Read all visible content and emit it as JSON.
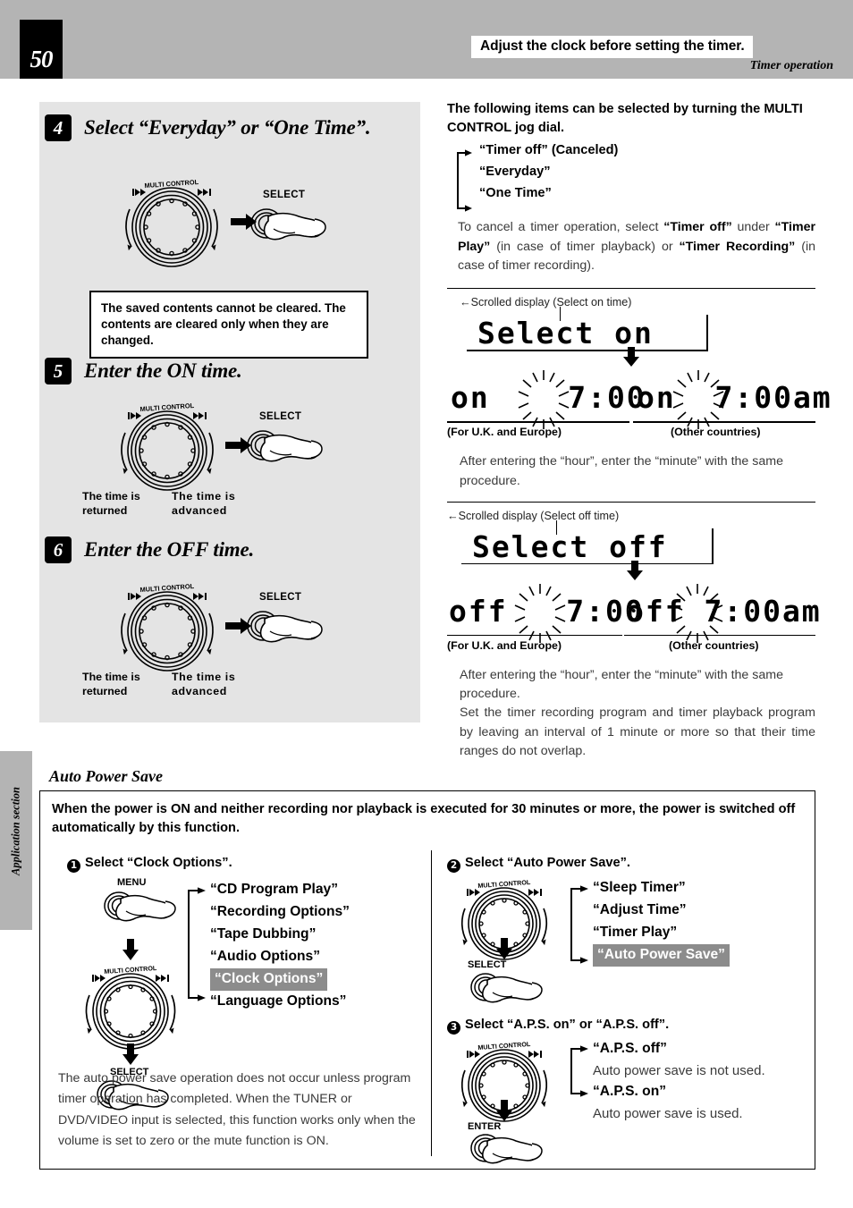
{
  "header": {
    "page_number": "50",
    "title": "Adjust the clock before setting the timer.",
    "subtitle": "Timer operation"
  },
  "side_tab": {
    "label": "Application section"
  },
  "steps": [
    {
      "number": "4",
      "title": "Select “Everyday” or “One Time”.",
      "button_label": "SELECT",
      "note": "The saved contents cannot be cleared. The contents are cleared only when they are changed."
    },
    {
      "number": "5",
      "title": "Enter the ON time.",
      "button_label": "SELECT",
      "caption_left": "The time is returned",
      "caption_right": "The time is advanced"
    },
    {
      "number": "6",
      "title": "Enter the OFF time.",
      "button_label": "SELECT",
      "caption_left": "The time is returned",
      "caption_right": "The time is advanced"
    }
  ],
  "dial_label": "MULTI CONTROL",
  "right": {
    "intro": "The following items can be selected by turning the MULTI CONTROL jog dial.",
    "options": [
      "“Timer off” (Canceled)",
      "“Everyday”",
      "“One Time”"
    ],
    "cancel_note_parts": [
      {
        "text": "To cancel a timer operation, select ",
        "bold": false
      },
      {
        "text": "“Timer off”",
        "bold": true
      },
      {
        "text": " under ",
        "bold": false
      },
      {
        "text": "“Timer Play”",
        "bold": true
      },
      {
        "text": " (in case of timer playback) or ",
        "bold": false
      },
      {
        "text": "“Timer Recording”",
        "bold": true
      },
      {
        "text": " (in case of timer recording).",
        "bold": false
      }
    ],
    "on_block": {
      "scroll_note": "Scrolled display (Select on time)",
      "scroll_display": "Select on",
      "uk_display": "on    7:00",
      "uk_label": "(For U.K. and Europe)",
      "other_display": "on  7:00am",
      "other_label": "(Other countries)",
      "footnote": "After entering the “hour”, enter the “minute” with the same procedure."
    },
    "off_block": {
      "scroll_note": "Scrolled display (Select off time)",
      "scroll_display": "Select off",
      "uk_display": "off   7:00",
      "uk_label": "(For U.K. and Europe)",
      "other_display": "off 7:00am",
      "other_label": "(Other countries)",
      "footnote_1": "After entering the “hour”, enter the “minute” with the same procedure.",
      "footnote_2": "Set the timer recording program and timer playback program by leaving an interval of 1 minute or more so that their time ranges do not overlap."
    }
  },
  "auto_power_save": {
    "title": "Auto Power Save",
    "lead": "When the power is ON and neither recording nor playback is executed for 30 minutes or more, the power is switched off automatically by this function.",
    "substep_1": {
      "number": "❶",
      "heading": "Select “Clock Options”.",
      "menu_button": "MENU",
      "select_button": "SELECT",
      "menu_items": [
        {
          "label": "“CD Program Play”",
          "highlighted": false
        },
        {
          "label": "“Recording Options”",
          "highlighted": false
        },
        {
          "label": "“Tape Dubbing”",
          "highlighted": false
        },
        {
          "label": "“Audio Options”",
          "highlighted": false
        },
        {
          "label": "“Clock Options”",
          "highlighted": true
        },
        {
          "label": "“Language Options”",
          "highlighted": false
        }
      ],
      "footnote": "The auto power save operation does not occur unless program timer operation has completed. When the TUNER or DVD/VIDEO input is selected, this function works only when the volume is set to zero or the mute function is ON."
    },
    "substep_2": {
      "number": "❷",
      "heading": "Select “Auto Power Save”.",
      "select_button": "SELECT",
      "menu_items": [
        {
          "label": "“Sleep Timer”",
          "highlighted": false
        },
        {
          "label": "“Adjust Time”",
          "highlighted": false
        },
        {
          "label": "“Timer Play”",
          "highlighted": false
        },
        {
          "label": "“Auto Power Save”",
          "highlighted": true
        }
      ]
    },
    "substep_3": {
      "number": "❸",
      "heading": "Select “A.P.S. on” or “A.P.S. off”.",
      "enter_button": "ENTER",
      "options": [
        {
          "label": "“A.P.S. off”",
          "desc": "Auto power save is not used."
        },
        {
          "label": "“A.P.S. on”",
          "desc": "Auto power save is used."
        }
      ]
    }
  },
  "colors": {
    "header_band": "#b4b4b4",
    "panel_gray": "#e4e4e4",
    "highlight_gray": "#8c8c8c",
    "ink": "#000000"
  }
}
